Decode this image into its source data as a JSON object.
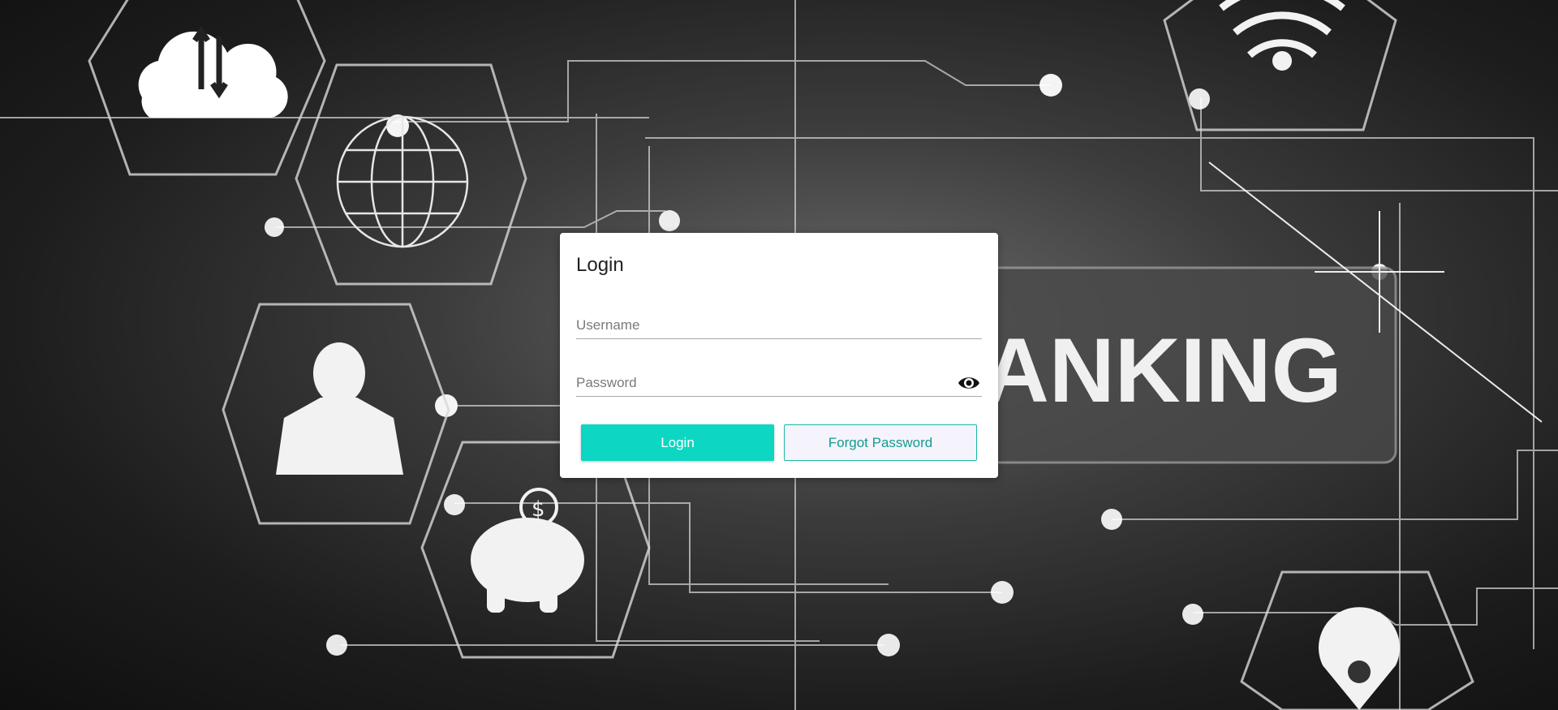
{
  "background": {
    "text": "ANKING"
  },
  "login": {
    "title": "Login",
    "username_placeholder": "Username",
    "username_value": "",
    "password_placeholder": "Password",
    "password_value": "",
    "login_button": "Login",
    "forgot_button": "Forgot Password"
  },
  "icons": {
    "show_password": "eye-icon",
    "cloud": "cloud-transfer-icon",
    "globe": "globe-icon",
    "user": "user-icon",
    "piggy_bank": "piggy-bank-icon",
    "wifi": "wifi-icon",
    "location": "location-pin-icon"
  },
  "colors": {
    "primary": "#0dd6c3",
    "forgot_border": "#1ab7a8",
    "forgot_text": "#139c8f"
  }
}
